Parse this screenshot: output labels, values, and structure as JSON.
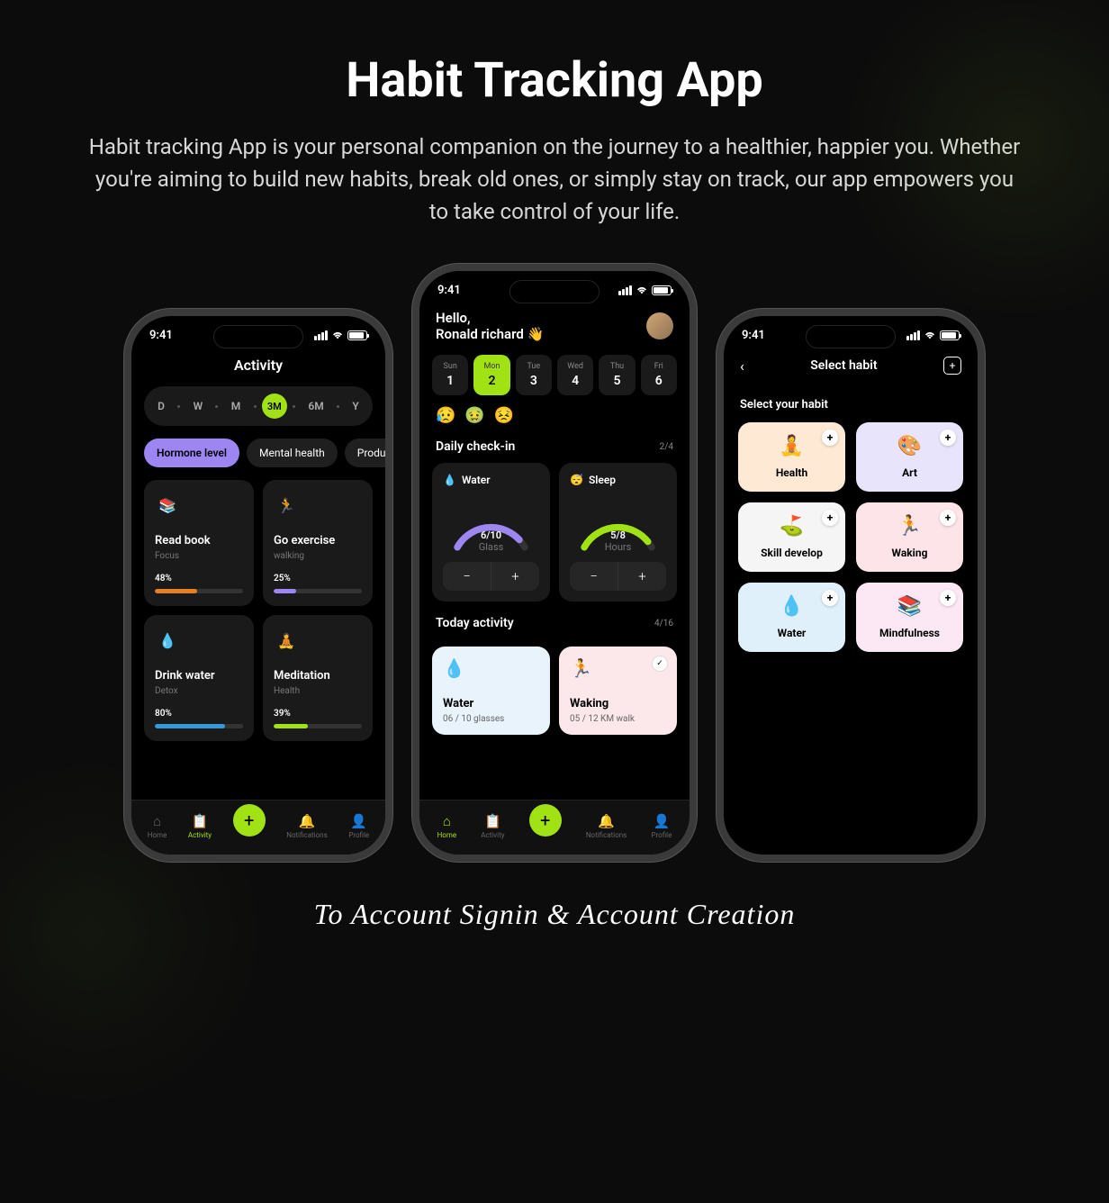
{
  "page": {
    "title": "Habit Tracking App",
    "subtitle": "Habit tracking App is your personal companion on the journey to a healthier, happier you. Whether you're aiming to build new habits, break old ones, or simply stay on track, our app empowers you to take control of your life.",
    "footer": "To Account Signin & Account Creation"
  },
  "status": {
    "time": "9:41"
  },
  "phoneA": {
    "title": "Activity",
    "ranges": [
      "D",
      "W",
      "M",
      "3M",
      "6M",
      "Y"
    ],
    "range_active": "3M",
    "tabs": [
      "Hormone level",
      "Mental health",
      "Produc"
    ],
    "tab_active": "Hormone level",
    "cards": [
      {
        "icon": "📚",
        "name": "Read book",
        "sub": "Focus",
        "pct": "48%",
        "fill": 48,
        "color": "#e67e22"
      },
      {
        "icon": "🏃",
        "name": "Go exercise",
        "sub": "walking",
        "pct": "25%",
        "fill": 25,
        "color": "#9d85f2"
      },
      {
        "icon": "💧",
        "name": "Drink water",
        "sub": "Detox",
        "pct": "80%",
        "fill": 80,
        "color": "#3498db"
      },
      {
        "icon": "🧘",
        "name": "Meditation",
        "sub": "Health",
        "pct": "39%",
        "fill": 39,
        "color": "#a1e214"
      }
    ],
    "nav": [
      "Home",
      "Activity",
      "",
      "Notifications",
      "Profile"
    ],
    "nav_active": "Activity"
  },
  "phoneB": {
    "hello_l1": "Hello,",
    "hello_l2": "Ronald richard 👋",
    "week": [
      {
        "dn": "Sun",
        "dd": "1"
      },
      {
        "dn": "Mon",
        "dd": "2"
      },
      {
        "dn": "Tue",
        "dd": "3"
      },
      {
        "dn": "Wed",
        "dd": "4"
      },
      {
        "dn": "Thu",
        "dd": "5"
      },
      {
        "dn": "Fri",
        "dd": "6"
      }
    ],
    "week_active": 1,
    "moods": [
      "😥",
      "🤢",
      "😣"
    ],
    "checkin_title": "Daily check-in",
    "checkin_count": "2/4",
    "checkin": [
      {
        "icon": "💧",
        "name": "Water",
        "val": "6/10",
        "lbl": "Glass",
        "color": "#9d85f2",
        "pct": 60
      },
      {
        "icon": "😴",
        "name": "Sleep",
        "val": "5/8",
        "lbl": "Hours",
        "color": "#a1e214",
        "pct": 62
      }
    ],
    "today_title": "Today activity",
    "today_count": "4/16",
    "today": [
      {
        "cls": "blue",
        "icon": "💧",
        "name": "Water",
        "sub": "06 / 10 glasses",
        "check": false,
        "iconColor": "#3498db"
      },
      {
        "cls": "pink",
        "icon": "🏃",
        "name": "Waking",
        "sub": "05 / 12 KM walk",
        "check": true,
        "iconColor": "#e74c3c"
      }
    ],
    "nav": [
      "Home",
      "Activity",
      "",
      "Notifications",
      "Profile"
    ],
    "nav_active": "Home"
  },
  "phoneC": {
    "title": "Select habit",
    "label": "Select your habit",
    "cards": [
      {
        "icon": "🧘",
        "name": "Health",
        "bg": "#fde9d4",
        "ic": "#e67e22"
      },
      {
        "icon": "🎨",
        "name": "Art",
        "bg": "#e8e4fb",
        "ic": "#6c5ce7"
      },
      {
        "icon": "⛳",
        "name": "Skill develop",
        "bg": "#f5f5f5",
        "ic": "#2c3e50"
      },
      {
        "icon": "🏃",
        "name": "Waking",
        "bg": "#fde4e8",
        "ic": "#e74c3c"
      },
      {
        "icon": "💧",
        "name": "Water",
        "bg": "#dff0fb",
        "ic": "#3498db"
      },
      {
        "icon": "📚",
        "name": "Mindfulness",
        "bg": "#fbe8f4",
        "ic": "#c0638f"
      }
    ]
  }
}
